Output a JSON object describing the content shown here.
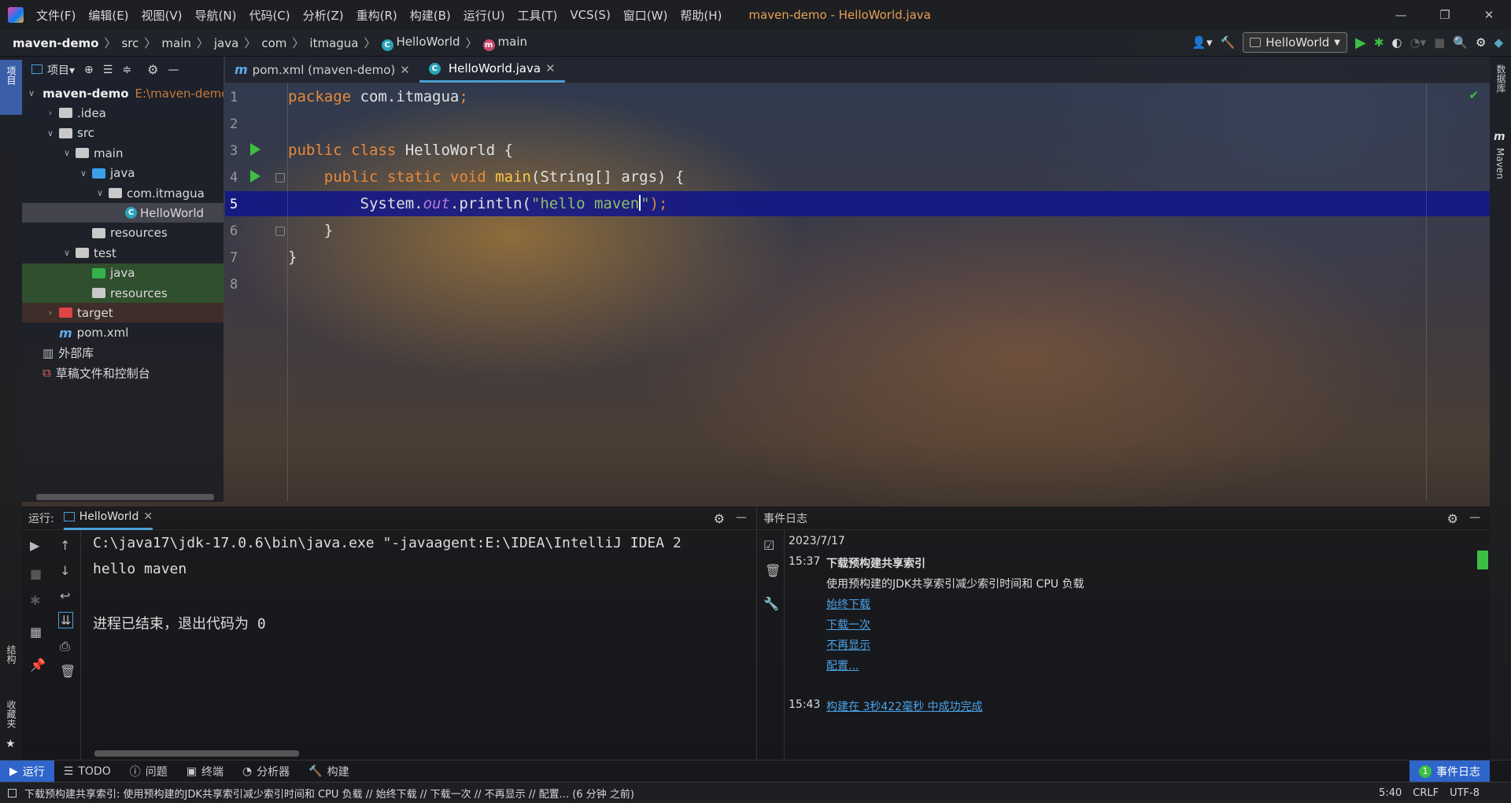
{
  "menu": {
    "items": [
      "文件(F)",
      "编辑(E)",
      "视图(V)",
      "导航(N)",
      "代码(C)",
      "分析(Z)",
      "重构(R)",
      "构建(B)",
      "运行(U)",
      "工具(T)",
      "VCS(S)",
      "窗口(W)",
      "帮助(H)"
    ],
    "window_title": "maven-demo - HelloWorld.java"
  },
  "breadcrumb": {
    "project": "maven-demo",
    "parts": [
      "src",
      "main",
      "java",
      "com",
      "itmagua"
    ],
    "class": "HelloWorld",
    "method": "main"
  },
  "toolbar": {
    "run_config": "HelloWorld"
  },
  "side_tabs": {
    "left_top": "项目",
    "left_bottom_1": "结构",
    "left_bottom_2": "收藏夹",
    "right_1": "数据库",
    "right_2": "Maven"
  },
  "project_panel": {
    "title": "项目",
    "tree": [
      {
        "label": "maven-demo",
        "path": "E:\\maven-demo",
        "level": 0,
        "expanded": true,
        "kind": "module"
      },
      {
        "label": ".idea",
        "level": 1,
        "expanded": false,
        "kind": "folder"
      },
      {
        "label": "src",
        "level": 1,
        "expanded": true,
        "kind": "folder"
      },
      {
        "label": "main",
        "level": 2,
        "expanded": true,
        "kind": "folder"
      },
      {
        "label": "java",
        "level": 3,
        "expanded": true,
        "kind": "source"
      },
      {
        "label": "com.itmagua",
        "level": 4,
        "expanded": true,
        "kind": "package"
      },
      {
        "label": "HelloWorld",
        "level": 5,
        "kind": "class",
        "selected": true
      },
      {
        "label": "resources",
        "level": 3,
        "kind": "resources"
      },
      {
        "label": "test",
        "level": 2,
        "expanded": true,
        "kind": "folder"
      },
      {
        "label": "java",
        "level": 3,
        "kind": "test-source"
      },
      {
        "label": "resources",
        "level": 3,
        "kind": "test-resources"
      },
      {
        "label": "target",
        "level": 1,
        "expanded": false,
        "kind": "excluded"
      },
      {
        "label": "pom.xml",
        "level": 1,
        "kind": "maven"
      },
      {
        "label": "外部库",
        "level": 0,
        "kind": "library"
      },
      {
        "label": "草稿文件和控制台",
        "level": 0,
        "kind": "scratch"
      }
    ]
  },
  "editor": {
    "tabs": [
      {
        "label": "pom.xml (maven-demo)",
        "icon": "maven-icon",
        "active": false
      },
      {
        "label": "HelloWorld.java",
        "icon": "class-icon",
        "active": true
      }
    ],
    "line_numbers": [
      "1",
      "2",
      "3",
      "4",
      "5",
      "6",
      "7",
      "8"
    ],
    "current_line": 5
  },
  "run_panel": {
    "label": "运行:",
    "tab": "HelloWorld",
    "console": [
      "C:\\java17\\jdk-17.0.6\\bin\\java.exe \"-javaagent:E:\\IDEA\\IntelliJ IDEA 2",
      "hello maven",
      "",
      "进程已结束，退出代码为 0"
    ]
  },
  "event_log": {
    "title": "事件日志",
    "date": "2023/7/17",
    "time1": "15:37",
    "headline": "下载预构建共享索引",
    "message": "使用预构建的JDK共享索引减少索引时间和 CPU 负载",
    "links": [
      "始终下载",
      "下载一次",
      "不再显示",
      "配置..."
    ],
    "time2": "15:43",
    "build_msg": "构建在 3秒422毫秒 中成功完成"
  },
  "bottom_tabs": [
    "运行",
    "TODO",
    "问题",
    "终端",
    "分析器",
    "构建"
  ],
  "event_log_button": {
    "badge": "1",
    "label": "事件日志"
  },
  "status": {
    "message": "下载预构建共享索引: 使用预构建的JDK共享索引减少索引时间和 CPU 负载 // 始终下载 // 下载一次 // 不再显示 // 配置... (6 分钟 之前)",
    "position": "5:40",
    "line_sep": "CRLF",
    "encoding": "UTF-8"
  },
  "colors": {
    "accent": "#2f65ca",
    "run_green": "#3dbf45",
    "current_line": "#0f148c"
  }
}
